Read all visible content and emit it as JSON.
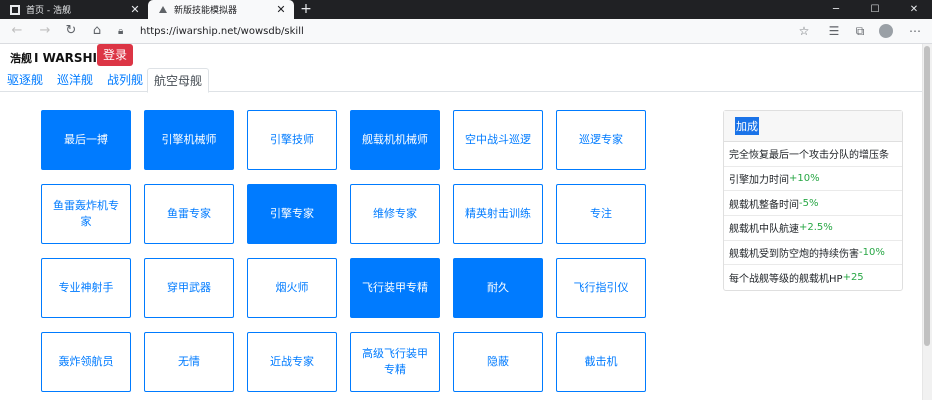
{
  "browser": {
    "tabs": [
      {
        "title": "首页 - 浩舰",
        "active": false
      },
      {
        "title": "新版技能模拟器",
        "active": true
      }
    ],
    "url": "https://iwarship.net/wowsdb/skill"
  },
  "site": {
    "brand_text": "I WARSHIP",
    "brand_mark": "浩舰",
    "login_label": "登录"
  },
  "navtabs": [
    {
      "label": "驱逐舰",
      "active": false
    },
    {
      "label": "巡洋舰",
      "active": false
    },
    {
      "label": "战列舰",
      "active": false
    },
    {
      "label": "航空母舰",
      "active": true
    }
  ],
  "skills": [
    {
      "name": "最后一搏",
      "selected": true
    },
    {
      "name": "引擎机械师",
      "selected": true
    },
    {
      "name": "引擎技师",
      "selected": false
    },
    {
      "name": "舰载机机械师",
      "selected": true
    },
    {
      "name": "空中战斗巡逻",
      "selected": false
    },
    {
      "name": "巡逻专家",
      "selected": false
    },
    {
      "name": "鱼雷轰炸机专家",
      "selected": false
    },
    {
      "name": "鱼雷专家",
      "selected": false
    },
    {
      "name": "引擎专家",
      "selected": true
    },
    {
      "name": "维修专家",
      "selected": false
    },
    {
      "name": "精英射击训练",
      "selected": false
    },
    {
      "name": "专注",
      "selected": false
    },
    {
      "name": "专业神射手",
      "selected": false
    },
    {
      "name": "穿甲武器",
      "selected": false
    },
    {
      "name": "烟火师",
      "selected": false
    },
    {
      "name": "飞行装甲专精",
      "selected": true
    },
    {
      "name": "耐久",
      "selected": true
    },
    {
      "name": "飞行指引仪",
      "selected": false
    },
    {
      "name": "轰炸领航员",
      "selected": false
    },
    {
      "name": "无情",
      "selected": false
    },
    {
      "name": "近战专家",
      "selected": false
    },
    {
      "name": "高级飞行装甲专精",
      "selected": false
    },
    {
      "name": "隐蔽",
      "selected": false
    },
    {
      "name": "截击机",
      "selected": false
    }
  ],
  "panel": {
    "title": "加成",
    "items": [
      {
        "text": "完全恢复最后一个攻击分队的增压条",
        "value": ""
      },
      {
        "text": "引擎加力时间",
        "value": "+10%"
      },
      {
        "text": "舰载机整备时间",
        "value": "-5%"
      },
      {
        "text": "舰载机中队航速",
        "value": "+2.5%"
      },
      {
        "text": "舰载机受到防空炮的持续伤害",
        "value": "-10%"
      },
      {
        "text": "每个战舰等级的舰载机HP",
        "value": "+25"
      }
    ]
  },
  "colors": {
    "accent": "#007bff",
    "login": "#dc3545",
    "positive": "#28a745"
  }
}
